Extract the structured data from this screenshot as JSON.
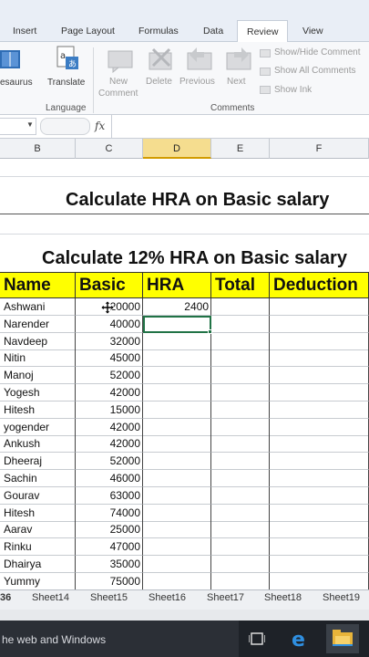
{
  "ribbon_tabs": {
    "insert": "Insert",
    "page_layout": "Page Layout",
    "formulas": "Formulas",
    "data": "Data",
    "review": "Review",
    "view": "View"
  },
  "ribbon": {
    "thesaurus": "esaurus",
    "translate": "Translate",
    "language_group": "Language",
    "new_comment_line1": "New",
    "new_comment_line2": "Comment",
    "delete": "Delete",
    "previous": "Previous",
    "next": "Next",
    "show_hide_comment": "Show/Hide Comment",
    "show_all_comments": "Show All Comments",
    "show_ink": "Show Ink",
    "comments_group": "Comments"
  },
  "formula_bar": {
    "fx": "fx"
  },
  "columns": [
    "B",
    "C",
    "D",
    "E",
    "F"
  ],
  "sheet": {
    "title1": "Calculate HRA on Basic salary",
    "title2": "Calculate 12% HRA on Basic salary",
    "headers": {
      "name": "Name",
      "basic": "Basic",
      "hra": "HRA",
      "total": "Total",
      "deduction": "Deduction"
    },
    "rows": [
      {
        "name": "Ashwani",
        "basic": "20000",
        "hra": "2400"
      },
      {
        "name": "Narender",
        "basic": "40000",
        "hra": ""
      },
      {
        "name": "Navdeep",
        "basic": "32000",
        "hra": ""
      },
      {
        "name": "Nitin",
        "basic": "45000",
        "hra": ""
      },
      {
        "name": "Manoj",
        "basic": "52000",
        "hra": ""
      },
      {
        "name": "Yogesh",
        "basic": "42000",
        "hra": ""
      },
      {
        "name": "Hitesh",
        "basic": "15000",
        "hra": ""
      },
      {
        "name": "yogender",
        "basic": "42000",
        "hra": ""
      },
      {
        "name": "Ankush",
        "basic": "42000",
        "hra": ""
      },
      {
        "name": "Dheeraj",
        "basic": "52000",
        "hra": ""
      },
      {
        "name": "Sachin",
        "basic": "46000",
        "hra": ""
      },
      {
        "name": "Gourav",
        "basic": "63000",
        "hra": ""
      },
      {
        "name": "Hitesh",
        "basic": "74000",
        "hra": ""
      },
      {
        "name": "Aarav",
        "basic": "25000",
        "hra": ""
      },
      {
        "name": "Rinku",
        "basic": "47000",
        "hra": ""
      },
      {
        "name": "Dhairya",
        "basic": "35000",
        "hra": ""
      },
      {
        "name": "Yummy",
        "basic": "75000",
        "hra": ""
      }
    ]
  },
  "sheet_tabs": {
    "current": "36",
    "tabs": [
      "Sheet14",
      "Sheet15",
      "Sheet16",
      "Sheet17",
      "Sheet18",
      "Sheet19"
    ]
  },
  "taskbar": {
    "search_text": "he web and Windows"
  },
  "colors": {
    "header_fill": "#ffff00",
    "selection": "#217346",
    "taskbar": "#1e2228"
  }
}
